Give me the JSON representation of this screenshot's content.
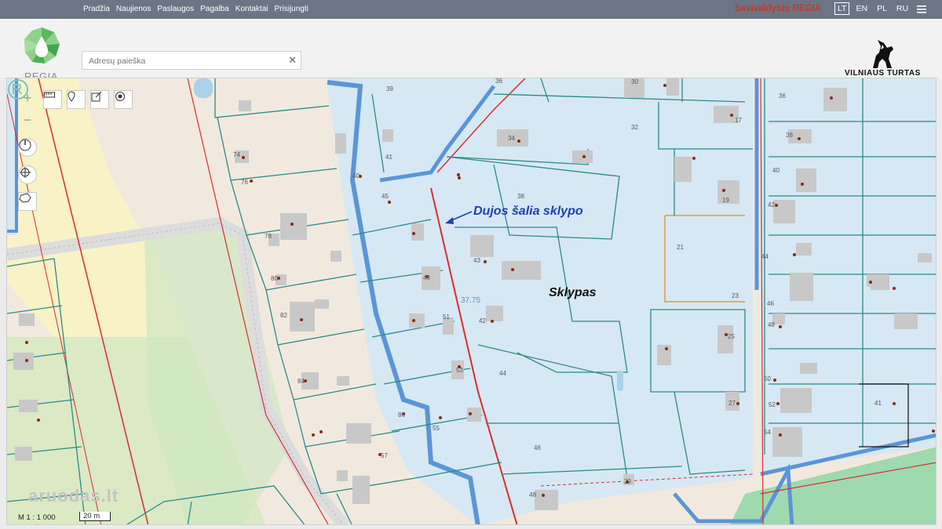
{
  "nav": {
    "items": [
      "Pradžia",
      "Naujienos",
      "Paslaugos",
      "Pagalba",
      "Kontaktai",
      "Prisijungti"
    ]
  },
  "brand": {
    "title": "Savivaldybių REGIA"
  },
  "languages": {
    "items": [
      "LT",
      "EN",
      "PL",
      "RU"
    ],
    "active": "LT"
  },
  "logo": {
    "text": "REGIA",
    "icon": "regia-drop-logo"
  },
  "search": {
    "placeholder": "Adresų paieška",
    "value": ""
  },
  "partner_logo": {
    "text": "VILNIAUS TURTAS",
    "icon": "wolf-logo"
  },
  "map": {
    "annotations": {
      "gas": "Dujos šalia sklypo",
      "plot": "Sklypas"
    },
    "parcel_area": "37.75",
    "house_numbers": [
      "74",
      "76",
      "78",
      "80",
      "82",
      "84",
      "86",
      "57",
      "39",
      "41",
      "45",
      "40",
      "49",
      "51",
      "53",
      "55",
      "36",
      "34",
      "38",
      "32",
      "30",
      "17",
      "19",
      "21",
      "23",
      "25",
      "27",
      "29",
      "36",
      "38",
      "40",
      "42",
      "44",
      "46",
      "48",
      "50",
      "52",
      "54",
      "41",
      "44",
      "46",
      "48",
      "43",
      "42"
    ],
    "scale": {
      "ratio": "M 1 : 1 000",
      "bar": "20 m"
    },
    "watermark": "aruodas.lt",
    "tools": [
      "zoom-in",
      "zoom-out",
      "measure-line",
      "place-marker",
      "edit-export",
      "target-point",
      "compass",
      "locate",
      "select-area"
    ]
  },
  "colors": {
    "topbar": "#6b7585",
    "brand": "#c0392b",
    "plot_fill": "#d6e8f4",
    "parcel_line": "#2b8a87",
    "gas_line": "#d62e2e",
    "annotation": "#1f3fb0"
  }
}
